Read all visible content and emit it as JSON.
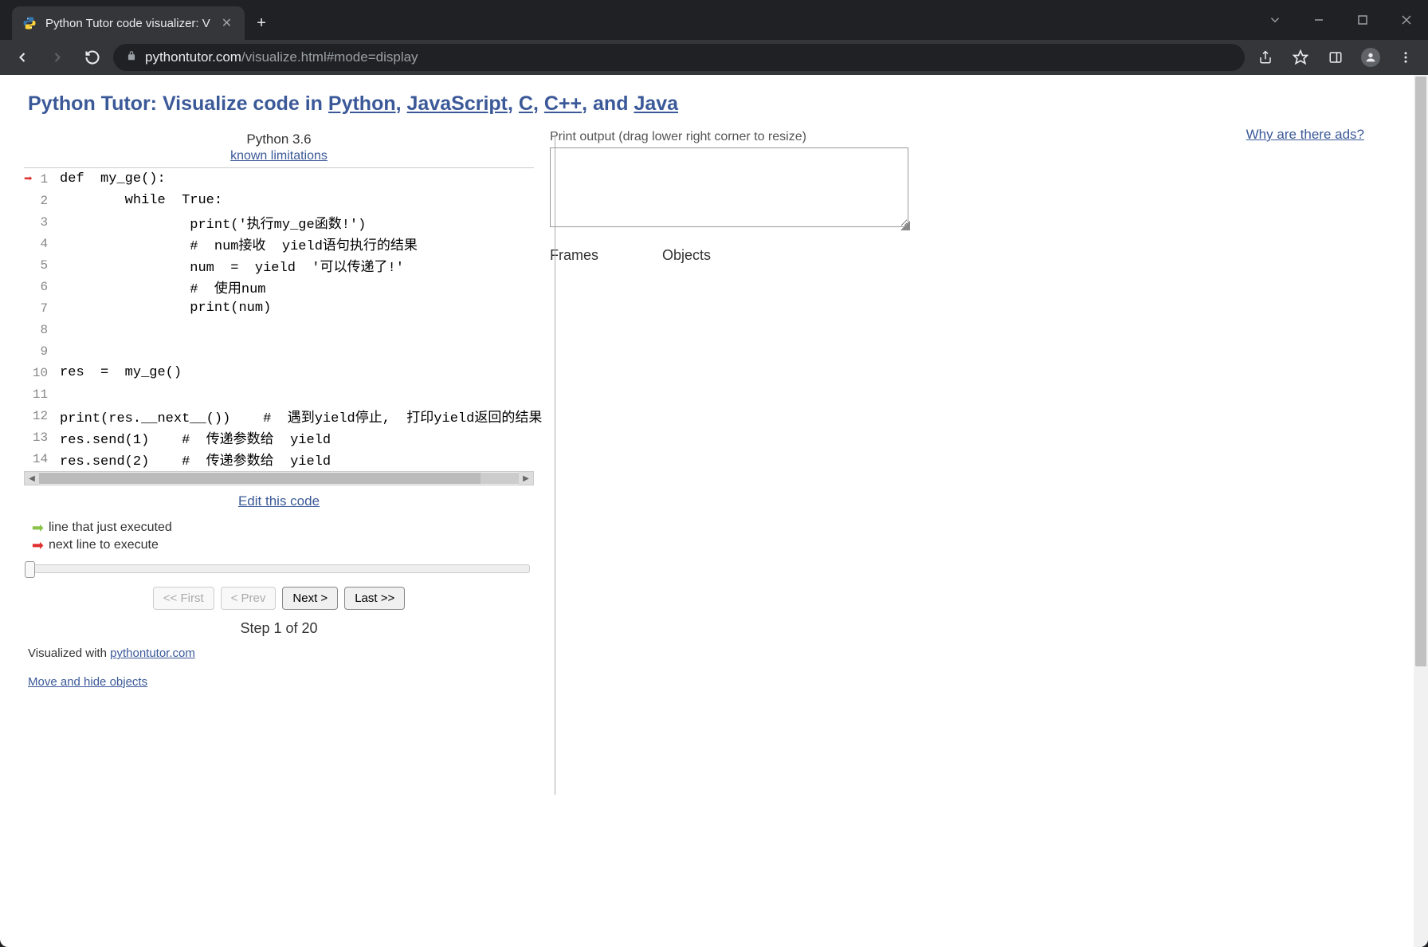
{
  "browser": {
    "tab_title": "Python Tutor code visualizer: V",
    "url_domain": "pythontutor.com",
    "url_path": "/visualize.html#mode=display"
  },
  "heading": {
    "prefix": "Python Tutor: Visualize code in ",
    "python": "Python",
    "sep1": ", ",
    "javascript": "JavaScript",
    "sep2": ", ",
    "c": "C",
    "sep3": ", ",
    "cpp": "C++",
    "sep4": ", and ",
    "java": "Java"
  },
  "python_header": {
    "version": "Python 3.6",
    "limitations": "known limitations"
  },
  "code_lines": [
    {
      "n": "1",
      "arrow": true,
      "text": "def  my_ge():"
    },
    {
      "n": "2",
      "arrow": false,
      "text": "        while  True:"
    },
    {
      "n": "3",
      "arrow": false,
      "text": "                print('执行my_ge函数!')"
    },
    {
      "n": "4",
      "arrow": false,
      "text": "                #  num接收  yield语句执行的结果"
    },
    {
      "n": "5",
      "arrow": false,
      "text": "                num  =  yield  '可以传递了!'"
    },
    {
      "n": "6",
      "arrow": false,
      "text": "                #  使用num"
    },
    {
      "n": "7",
      "arrow": false,
      "text": "                print(num)"
    },
    {
      "n": "8",
      "arrow": false,
      "text": ""
    },
    {
      "n": "9",
      "arrow": false,
      "text": ""
    },
    {
      "n": "10",
      "arrow": false,
      "text": "res  =  my_ge()"
    },
    {
      "n": "11",
      "arrow": false,
      "text": ""
    },
    {
      "n": "12",
      "arrow": false,
      "text": "print(res.__next__())    #  遇到yield停止,  打印yield返回的结果"
    },
    {
      "n": "13",
      "arrow": false,
      "text": "res.send(1)    #  传递参数给  yield"
    },
    {
      "n": "14",
      "arrow": false,
      "text": "res.send(2)    #  传递参数给  yield"
    }
  ],
  "edit_link": "Edit this code",
  "legend": {
    "just_executed": "line that just executed",
    "next_line": "next line to execute"
  },
  "nav": {
    "first": "<< First",
    "prev": "< Prev",
    "next": "Next >",
    "last": "Last >>"
  },
  "step_info": "Step 1 of 20",
  "footer": {
    "visualized_prefix": "Visualized with ",
    "visualized_link": "pythontutor.com",
    "move_hide": "Move and hide objects"
  },
  "right": {
    "print_output_label": "Print output (drag lower right corner to resize)",
    "frames": "Frames",
    "objects": "Objects"
  },
  "ads_link": "Why are there ads?"
}
